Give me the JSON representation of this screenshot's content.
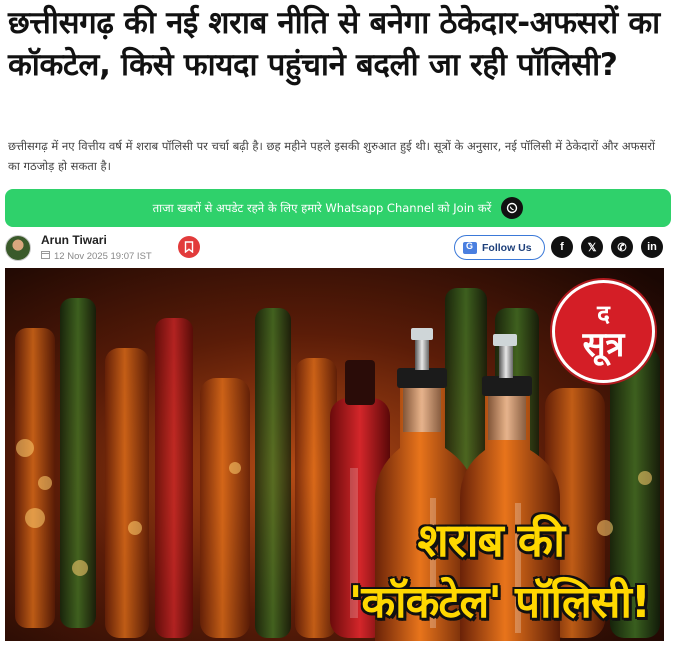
{
  "article": {
    "headline": "छत्तीसगढ़ की नई शराब नीति से बनेगा ठेकेदार-अफसरों का कॉकटेल, किसे फायदा पहुंचाने बदली जा रही पॉलिसी?",
    "summary": "छत्तीसगढ़ में नए वित्तीय वर्ष में शराब पॉलिसी पर चर्चा बढ़ी है। छह महीने पहले इसकी शुरुआत हुई थी। सूत्रों के अनुसार, नई पॉलिसी में ठेकेदारों और अफसरों का गठजोड़ हो सकता है।"
  },
  "whatsapp_banner": {
    "text": "ताजा खबरों से अपडेट रहने के लिए हमारे Whatsapp Channel को Join करें",
    "icon": "whatsapp-icon"
  },
  "author": {
    "name": "Arun Tiwari",
    "date": "12 Nov 2025 19:07 IST"
  },
  "actions": {
    "follow_label": "Follow Us",
    "share_icons": [
      "facebook-icon",
      "x-icon",
      "whatsapp-icon",
      "linkedin-icon"
    ],
    "share_glyphs": [
      "f",
      "𝕏",
      "✆",
      "in"
    ]
  },
  "hero": {
    "logo_line1": "द",
    "logo_line2": "सूत्र",
    "overlay_line1": "शराब की",
    "overlay_line2": "'कॉकटेल' पॉलिसी!"
  },
  "colors": {
    "whatsapp_green": "#2fd16b",
    "bookmark_red": "#e23b3b",
    "logo_red": "#d41e26",
    "overlay_yellow": "#ffd800"
  }
}
